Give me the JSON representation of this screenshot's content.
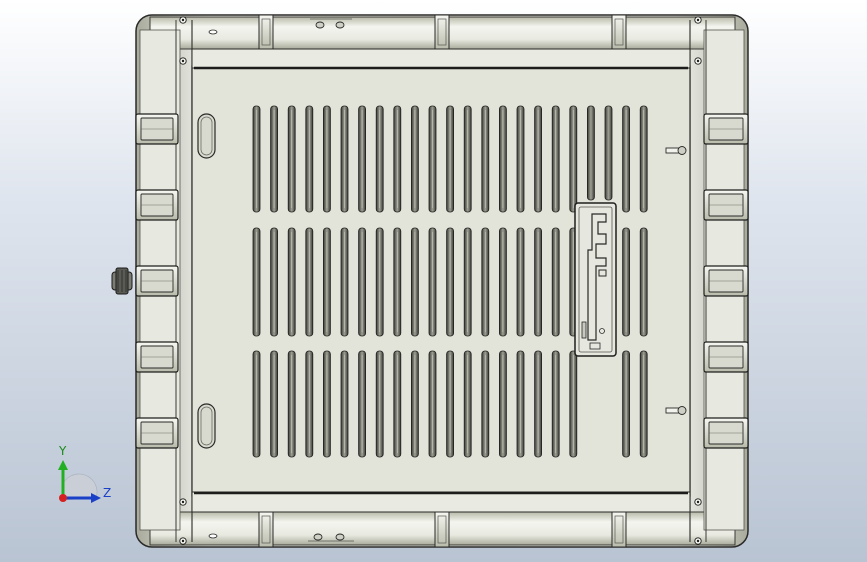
{
  "viewport": {
    "background_top": "#ffffff",
    "background_bottom": "#b9c4d3",
    "model_fill": "#e4e5dc",
    "model_stroke": "#2a2a28"
  },
  "triad": {
    "y_label": "Y",
    "z_label": "Z",
    "y_color": "#22b022",
    "z_color": "#1a40c8",
    "x_color": "#d62020"
  },
  "model": {
    "vent_columns": 23,
    "vent_rows": 3,
    "side_handles_per_side": 5,
    "top_latches": 4
  }
}
